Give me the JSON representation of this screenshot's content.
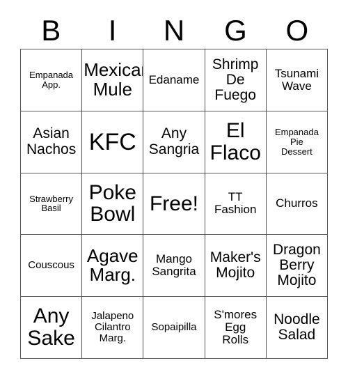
{
  "card": {
    "header_letters": [
      "B",
      "I",
      "N",
      "G",
      "O"
    ],
    "columns": 5,
    "rows": 5,
    "free_space_label": "Free!",
    "border_color": "#555555",
    "text_color": "#000000",
    "background_color": "#ffffff",
    "cells": [
      {
        "text": "Empanada\nApp.",
        "size": "xs",
        "column": "B",
        "row": 1
      },
      {
        "text": "Mexican\nMule",
        "size": "xl",
        "column": "I",
        "row": 1
      },
      {
        "text": "Edaname",
        "size": "m",
        "column": "N",
        "row": 1
      },
      {
        "text": "Shrimp\nDe\nFuego",
        "size": "l",
        "column": "G",
        "row": 1
      },
      {
        "text": "Tsunami\nWave",
        "size": "m",
        "column": "O",
        "row": 1
      },
      {
        "text": "Asian\nNachos",
        "size": "l",
        "column": "B",
        "row": 2
      },
      {
        "text": "KFC",
        "size": "huge",
        "column": "I",
        "row": 2
      },
      {
        "text": "Any\nSangria",
        "size": "l",
        "column": "N",
        "row": 2
      },
      {
        "text": "El\nFlaco",
        "size": "xxl",
        "column": "G",
        "row": 2
      },
      {
        "text": "Empanada\nPie\nDessert",
        "size": "xs",
        "column": "O",
        "row": 2
      },
      {
        "text": "Strawberry\nBasil",
        "size": "xs",
        "column": "B",
        "row": 3
      },
      {
        "text": "Poke\nBowl",
        "size": "xxl",
        "column": "I",
        "row": 3
      },
      {
        "text": "Free!",
        "size": "xxl",
        "column": "N",
        "row": 3
      },
      {
        "text": "TT\nFashion",
        "size": "m",
        "column": "G",
        "row": 3
      },
      {
        "text": "Churros",
        "size": "m",
        "column": "O",
        "row": 3
      },
      {
        "text": "Couscous",
        "size": "s",
        "column": "B",
        "row": 4
      },
      {
        "text": "Agave\nMarg.",
        "size": "xl",
        "column": "I",
        "row": 4
      },
      {
        "text": "Mango\nSangrita",
        "size": "m",
        "column": "N",
        "row": 4
      },
      {
        "text": "Maker's\nMojito",
        "size": "l",
        "column": "G",
        "row": 4
      },
      {
        "text": "Dragon\nBerry\nMojito",
        "size": "l",
        "column": "O",
        "row": 4
      },
      {
        "text": "Any\nSake",
        "size": "xxl",
        "column": "B",
        "row": 5
      },
      {
        "text": "Jalapeno\nCilantro\nMarg.",
        "size": "s",
        "column": "I",
        "row": 5
      },
      {
        "text": "Sopaipilla",
        "size": "s",
        "column": "N",
        "row": 5
      },
      {
        "text": "S'mores\nEgg\nRolls",
        "size": "m",
        "column": "G",
        "row": 5
      },
      {
        "text": "Noodle\nSalad",
        "size": "l",
        "column": "O",
        "row": 5
      }
    ]
  }
}
